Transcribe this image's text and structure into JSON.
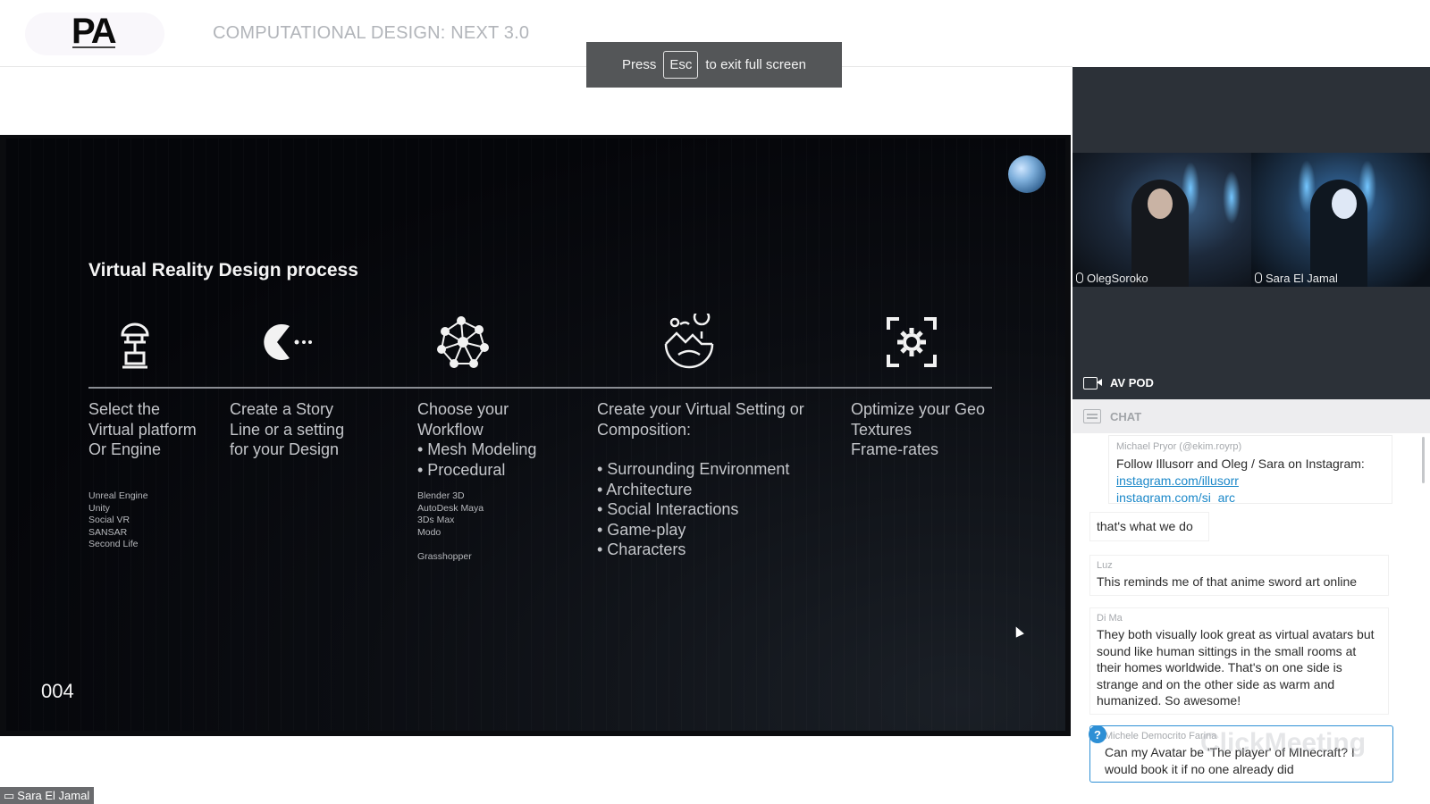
{
  "header": {
    "logo": "PA",
    "event_title": "COMPUTATIONAL DESIGN: NEXT 3.0"
  },
  "fullscreen_toast": {
    "press": "Press",
    "key": "Esc",
    "suffix": "to exit full screen"
  },
  "slide": {
    "title": "Virtual Reality Design process",
    "number": "004",
    "steps": [
      {
        "icon": "vr-platform-icon",
        "lines": [
          "Select the",
          "Virtual platform",
          "Or Engine"
        ],
        "small_list": [
          "Unreal Engine",
          "Unity",
          "Social VR",
          "SANSAR",
          "Second Life"
        ]
      },
      {
        "icon": "pacman-story-icon",
        "lines": [
          "Create a Story",
          "Line or a setting",
          "for your Design"
        ]
      },
      {
        "icon": "network-mesh-icon",
        "lines": [
          "Choose your",
          "Workflow"
        ],
        "bullets": [
          "• Mesh Modeling",
          "• Procedural"
        ],
        "small_list": [
          "Blender 3D",
          "AutoDesk Maya",
          "3Ds Max",
          "Modo",
          "",
          "Grasshopper"
        ]
      },
      {
        "icon": "environment-globe-icon",
        "lines": [
          "Create your Virtual Setting or",
          "Composition:"
        ],
        "bullets": [
          "• Surrounding Environment",
          "• Architecture",
          "• Social Interactions",
          "• Game-play",
          "• Characters"
        ]
      },
      {
        "icon": "optimize-gear-icon",
        "lines": [
          "Optimize your Geo",
          "Textures",
          "Frame-rates"
        ]
      }
    ]
  },
  "presenter_tag": "Sara El Jamal",
  "videos": [
    {
      "name": "OlegSoroko"
    },
    {
      "name": "Sara El Jamal"
    }
  ],
  "av_pod_label": "AV POD",
  "chat": {
    "header": "CHAT",
    "pinned": {
      "author": "Michael Pryor (@ekim.royrp)",
      "text": "Follow Illusorr and Oleg / Sara on Instagram:",
      "links": [
        "instagram.com/illusorr",
        "instagram.com/si_arc"
      ]
    },
    "messages": [
      {
        "author": "",
        "text": "that's what we do"
      },
      {
        "author": "Luz",
        "text": "This reminds me of that anime sword art online"
      },
      {
        "author": "Di Ma",
        "text": "They both visually look great as virtual avatars but sound like human sittings in the small rooms at their homes worldwide. That's on one side is strange and on the other side as warm and humanized. So awesome!"
      },
      {
        "author": "Michele Democrito Farina",
        "text": "Can my Avatar be 'The player' of MInecraft? I would book it if no one already did"
      }
    ],
    "question_badge": "?",
    "watermark": "ClickMeeting"
  }
}
